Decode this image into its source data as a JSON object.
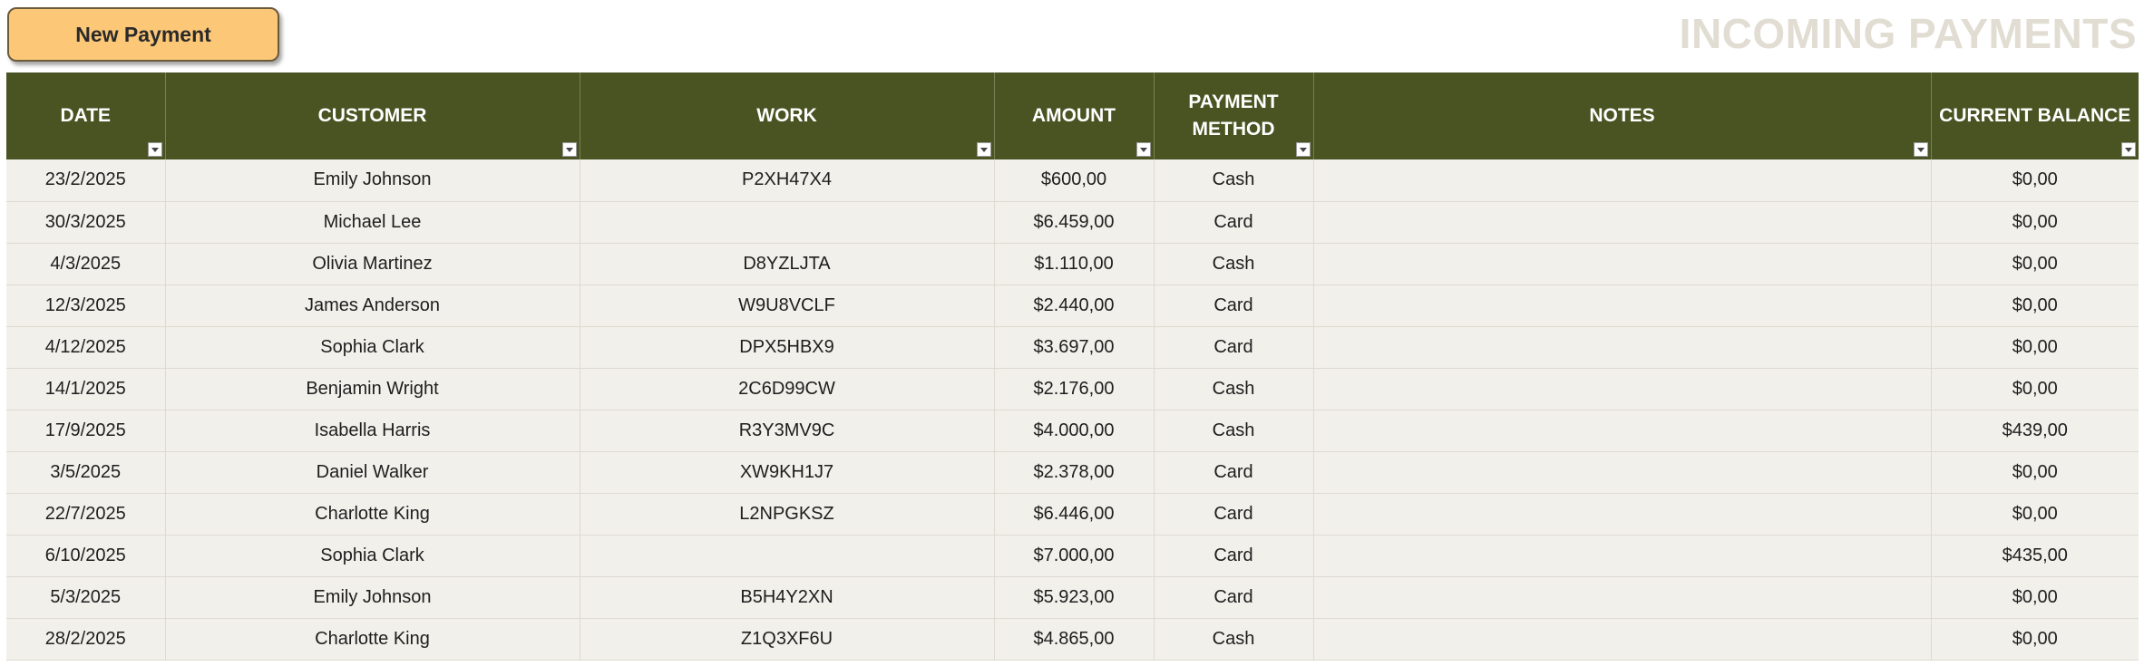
{
  "toolbar": {
    "new_payment_label": "New Payment"
  },
  "page": {
    "title": "INCOMING PAYMENTS"
  },
  "table": {
    "headers": {
      "date": "DATE",
      "customer": "CUSTOMER",
      "work": "WORK",
      "amount": "AMOUNT",
      "payment_method_line1": "PAYMENT",
      "payment_method_line2": "METHOD",
      "notes": "NOTES",
      "current_balance": "CURRENT BALANCE"
    },
    "rows": [
      {
        "date": "23/2/2025",
        "customer": "Emily Johnson",
        "work": "P2XH47X4",
        "amount": "$600,00",
        "method": "Cash",
        "notes": "",
        "balance": "$0,00"
      },
      {
        "date": "30/3/2025",
        "customer": "Michael Lee",
        "work": "",
        "amount": "$6.459,00",
        "method": "Card",
        "notes": "",
        "balance": "$0,00"
      },
      {
        "date": "4/3/2025",
        "customer": "Olivia Martinez",
        "work": "D8YZLJTA",
        "amount": "$1.110,00",
        "method": "Cash",
        "notes": "",
        "balance": "$0,00"
      },
      {
        "date": "12/3/2025",
        "customer": "James Anderson",
        "work": "W9U8VCLF",
        "amount": "$2.440,00",
        "method": "Card",
        "notes": "",
        "balance": "$0,00"
      },
      {
        "date": "4/12/2025",
        "customer": "Sophia Clark",
        "work": "DPX5HBX9",
        "amount": "$3.697,00",
        "method": "Card",
        "notes": "",
        "balance": "$0,00"
      },
      {
        "date": "14/1/2025",
        "customer": "Benjamin Wright",
        "work": "2C6D99CW",
        "amount": "$2.176,00",
        "method": "Cash",
        "notes": "",
        "balance": "$0,00"
      },
      {
        "date": "17/9/2025",
        "customer": "Isabella Harris",
        "work": "R3Y3MV9C",
        "amount": "$4.000,00",
        "method": "Cash",
        "notes": "",
        "balance": "$439,00"
      },
      {
        "date": "3/5/2025",
        "customer": "Daniel Walker",
        "work": "XW9KH1J7",
        "amount": "$2.378,00",
        "method": "Card",
        "notes": "",
        "balance": "$0,00"
      },
      {
        "date": "22/7/2025",
        "customer": "Charlotte King",
        "work": "L2NPGKSZ",
        "amount": "$6.446,00",
        "method": "Card",
        "notes": "",
        "balance": "$0,00"
      },
      {
        "date": "6/10/2025",
        "customer": "Sophia Clark",
        "work": "",
        "amount": "$7.000,00",
        "method": "Card",
        "notes": "",
        "balance": "$435,00"
      },
      {
        "date": "5/3/2025",
        "customer": "Emily Johnson",
        "work": "B5H4Y2XN",
        "amount": "$5.923,00",
        "method": "Card",
        "notes": "",
        "balance": "$0,00"
      },
      {
        "date": "28/2/2025",
        "customer": "Charlotte King",
        "work": "Z1Q3XF6U",
        "amount": "$4.865,00",
        "method": "Cash",
        "notes": "",
        "balance": "$0,00"
      }
    ]
  },
  "colors": {
    "header_bg": "#4a5322",
    "row_bg": "#f2f0ea",
    "button_bg": "#fcc878",
    "title_color": "#e2ddd3"
  },
  "icons": {
    "filter": "filter-dropdown-icon"
  }
}
